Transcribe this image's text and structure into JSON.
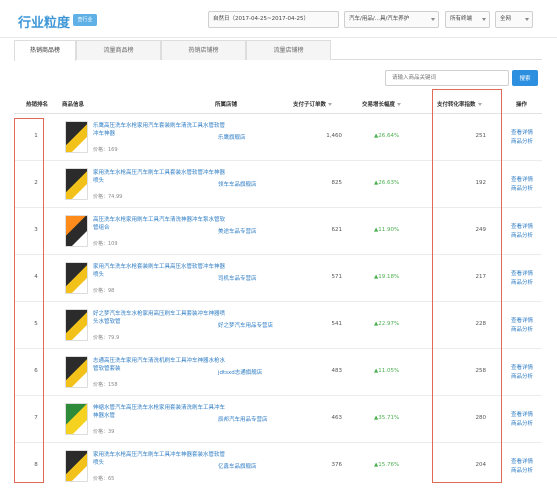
{
  "header": {
    "title": "行业粒度",
    "badge": "查行业",
    "date_range": "自然日（2017-04-25~2017-04-25）",
    "category": "汽车/用品/...具/汽车养护",
    "terminal": "所有终端",
    "network": "全网"
  },
  "tabs": [
    {
      "label": "热销商品榜"
    },
    {
      "label": "流量商品榜"
    },
    {
      "label": "热销店铺榜"
    },
    {
      "label": "流量店铺榜"
    }
  ],
  "search": {
    "placeholder": "请输入商品关键词",
    "button": "搜索"
  },
  "columns": {
    "rank": "热销排名",
    "product": "商品信息",
    "store": "所属店铺",
    "orders": "支付子订单数",
    "growth": "交易增长幅度",
    "conversion": "支付转化率指数",
    "actions": "操作"
  },
  "rows": [
    {
      "rank": "1",
      "name": "乐鹰高压洗车水枪家用汽车套装刷车清洗工具水管软管冲车神器",
      "price": "价格：169",
      "store": "乐鹰旗舰店",
      "orders": "1,460",
      "growth": "26.64%",
      "conversion": "251",
      "act1": "查看详情",
      "act2": "商品分析"
    },
    {
      "rank": "2",
      "name": "家用洗车水枪高压汽车刷车工具套装水管软管冲车神器喷头",
      "price": "价格：74.99",
      "store": "领车车品旗舰店",
      "orders": "825",
      "growth": "26.63%",
      "conversion": "192",
      "act1": "查看详情",
      "act2": "商品分析"
    },
    {
      "rank": "3",
      "name": "高压洗车水枪家用刷车工具汽车清洗神器冲车泵水管软管组合",
      "price": "价格：109",
      "store": "美途车品专营店",
      "orders": "621",
      "growth": "11.90%",
      "conversion": "249",
      "act1": "查看详情",
      "act2": "商品分析"
    },
    {
      "rank": "4",
      "name": "家用汽车洗车水枪套装刷车工具高压水管软管冲车神器喷头",
      "price": "价格：98",
      "store": "司机车品专营店",
      "orders": "571",
      "growth": "19.18%",
      "conversion": "217",
      "act1": "查看详情",
      "act2": "商品分析"
    },
    {
      "rank": "5",
      "name": "好之梦汽车洗车水枪家用高压刷车工具套装冲车神器喷头水管软管",
      "price": "价格：79.9",
      "store": "好之梦汽车用品专营店",
      "orders": "541",
      "growth": "22.97%",
      "conversion": "228",
      "act1": "查看详情",
      "act2": "商品分析"
    },
    {
      "rank": "6",
      "name": "志通高压洗车家用汽车清洗机刷车工具冲车神器水枪水管软管套装",
      "price": "价格：158",
      "store": "jdtsxd志通旗舰店",
      "orders": "483",
      "growth": "11.05%",
      "conversion": "258",
      "act1": "查看详情",
      "act2": "商品分析"
    },
    {
      "rank": "7",
      "name": "伸缩水管汽车高压洗车水枪家用套装清洗刷车工具冲车神器水管",
      "price": "价格：39",
      "store": "辰邦汽车用品专营店",
      "orders": "463",
      "growth": "35.71%",
      "conversion": "280",
      "act1": "查看详情",
      "act2": "商品分析"
    },
    {
      "rank": "8",
      "name": "家用洗车水枪高压汽车刷车工具冲车神器套装水管软管喷头",
      "price": "价格：65",
      "store": "亿鑫车品旗舰店",
      "orders": "376",
      "growth": "15.76%",
      "conversion": "204",
      "act1": "查看详情",
      "act2": "商品分析"
    }
  ]
}
